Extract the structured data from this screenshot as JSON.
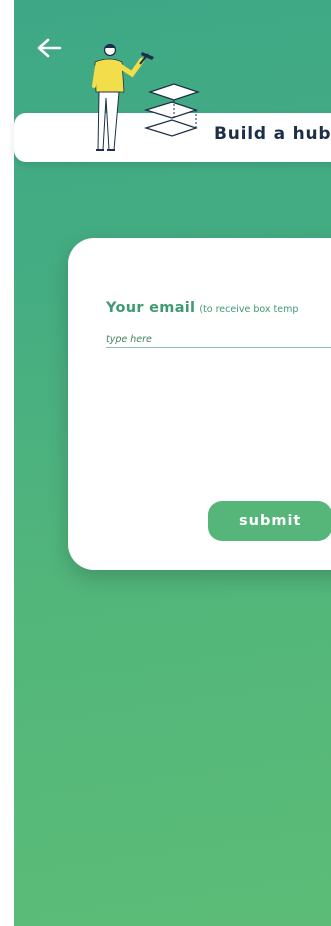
{
  "header": {
    "title": "Build a hub"
  },
  "form": {
    "email_label": "Your email",
    "email_hint": "(to receive box temp",
    "email_placeholder": "type here",
    "submit_label": "submit"
  },
  "icons": {
    "back": "back-arrow-icon",
    "illustration": "builder-with-hammer-and-layers-illustration"
  },
  "colors": {
    "background_top": "#3ea886",
    "background_bottom": "#5cbc77",
    "title_text": "#1d2f47",
    "accent_green": "#3f9a72",
    "button_green": "#56b679"
  }
}
